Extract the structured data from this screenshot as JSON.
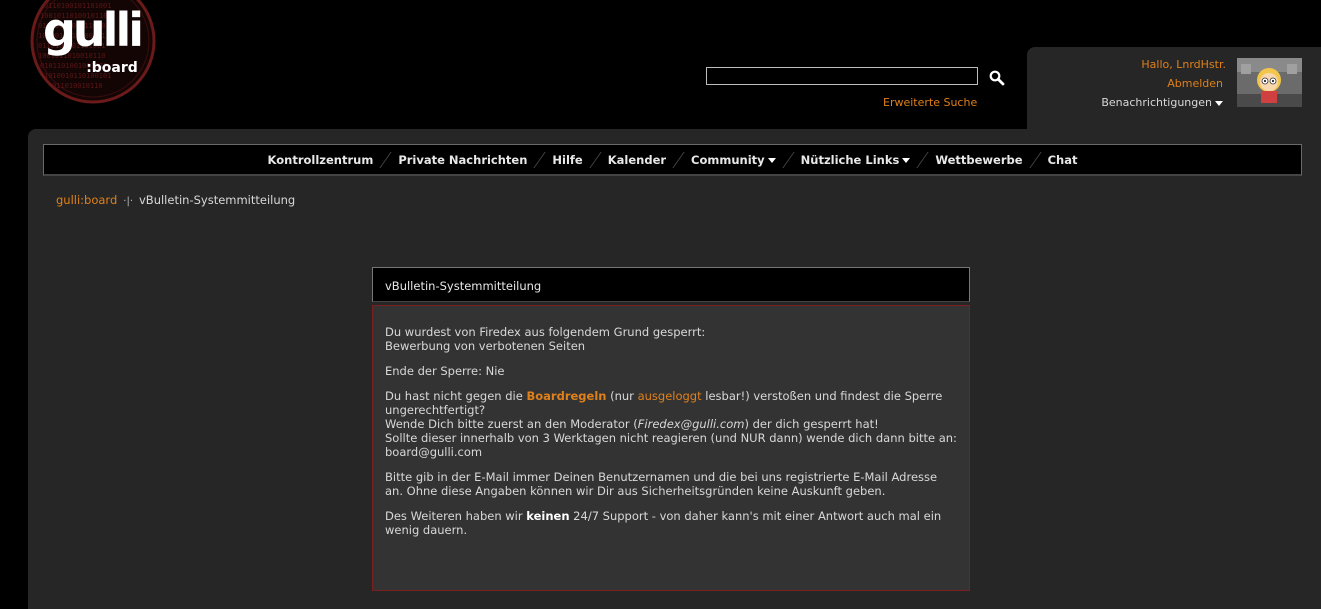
{
  "logo": {
    "main": "gulli",
    "sub": ":board"
  },
  "search": {
    "value": "",
    "advanced_label": "Erweiterte Suche"
  },
  "user": {
    "greeting": "Hallo, LnrdHstr.",
    "logout": "Abmelden",
    "notifications": "Benachrichtigungen"
  },
  "nav": [
    {
      "label": "Kontrollzentrum"
    },
    {
      "label": "Private Nachrichten"
    },
    {
      "label": "Hilfe"
    },
    {
      "label": "Kalender"
    },
    {
      "label": "Community"
    },
    {
      "label": "Nützliche Links"
    },
    {
      "label": "Wettbewerbe"
    },
    {
      "label": "Chat"
    }
  ],
  "breadcrumb": {
    "home": "gulli:board",
    "separator": "·|·",
    "current": "vBulletin-Systemmitteilung"
  },
  "message": {
    "title": "vBulletin-Systemmitteilung",
    "p1_line1": "Du wurdest von Firedex aus folgendem Grund gesperrt:",
    "p1_line2": "Bewerbung von verbotenen Seiten",
    "p2": "Ende der Sperre: Nie",
    "p3_a": "Du hast nicht gegen die ",
    "p3_link_rules": "Boardregeln",
    "p3_b": " (nur ",
    "p3_link_loggedout": "ausgeloggt",
    "p3_c": " lesbar!) verstoßen und findest die Sperre ungerechtfertigt?",
    "p3_d": "Wende Dich bitte zuerst an den Moderator (",
    "p3_email_italic": "Firedex@gulli.com",
    "p3_e": ") der dich gesperrt hat!",
    "p3_f": "Sollte dieser innerhalb von 3 Werktagen nicht reagieren (und NUR dann) wende dich dann bitte an:",
    "p3_g": "board@gulli.com",
    "p4": "Bitte gib in der E-Mail immer Deinen Benutzernamen und die bei uns registrierte E-Mail Adresse an. Ohne diese Angaben können wir Dir aus Sicherheitsgründen keine Auskunft geben.",
    "p5_a": "Des Weiteren haben wir ",
    "p5_bold": "keinen",
    "p5_b": " 24/7 Support - von daher kann's mit einer Antwort auch mal ein wenig dauern."
  },
  "colors": {
    "accent": "#e0801a",
    "panel": "#262626",
    "message_border": "#7a2020"
  }
}
